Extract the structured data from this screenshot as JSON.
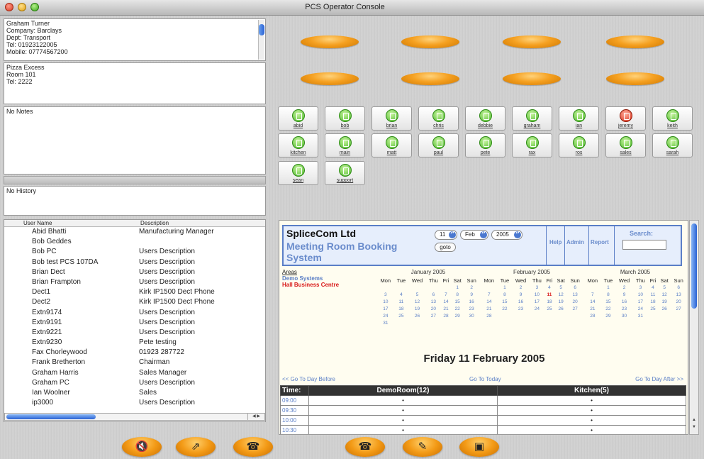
{
  "window": {
    "title": "PCS Operator Console"
  },
  "contact": {
    "lines": [
      "Graham Turner",
      "Company: Barclays",
      "Dept: Transport",
      "Tel: 01923122005",
      "Mobile: 07774567200"
    ]
  },
  "location": {
    "lines": [
      "Pizza Excess",
      "Room 101",
      "Tel: 2222"
    ]
  },
  "notes": {
    "text": "No Notes"
  },
  "history": {
    "text": "No History"
  },
  "user_table": {
    "columns": [
      "User Name",
      "Description"
    ],
    "rows": [
      [
        "Abid Bhatti",
        "Manufacturing Manager"
      ],
      [
        "Bob Geddes",
        ""
      ],
      [
        "Bob PC",
        "Users Description"
      ],
      [
        "Bob test PCS 107DA",
        "Users Description"
      ],
      [
        "Brian Dect",
        "Users Description"
      ],
      [
        "Brian Frampton",
        "Users Description"
      ],
      [
        "Dect1",
        "Kirk IP1500 Dect Phone"
      ],
      [
        "Dect2",
        "Kirk IP1500 Dect Phone"
      ],
      [
        "Extn9174",
        "Users Description"
      ],
      [
        "Extn9191",
        "Users Description"
      ],
      [
        "Extn9221",
        "Users Description"
      ],
      [
        "Extn9230",
        "Pete testing"
      ],
      [
        "Fax Chorleywood",
        "01923 287722"
      ],
      [
        "Frank Bretherton",
        "Chairman"
      ],
      [
        "Graham Harris",
        "Sales Manager"
      ],
      [
        "Graham PC",
        "Users Description"
      ],
      [
        "Ian Woolner",
        "Sales"
      ],
      [
        "ip3000",
        "Users Description"
      ]
    ]
  },
  "extensions": [
    {
      "label": "abid",
      "state": "idle"
    },
    {
      "label": "bob",
      "state": "idle"
    },
    {
      "label": "brian",
      "state": "idle"
    },
    {
      "label": "chris",
      "state": "idle"
    },
    {
      "label": "debbie",
      "state": "idle"
    },
    {
      "label": "graham",
      "state": "idle"
    },
    {
      "label": "ian",
      "state": "idle"
    },
    {
      "label": "jeremy",
      "state": "busy"
    },
    {
      "label": "keith",
      "state": "idle"
    },
    {
      "label": "kitchen",
      "state": "idle"
    },
    {
      "label": "main",
      "state": "idle"
    },
    {
      "label": "matt",
      "state": "idle"
    },
    {
      "label": "paul",
      "state": "idle"
    },
    {
      "label": "pete",
      "state": "idle"
    },
    {
      "label": "rax",
      "state": "idle"
    },
    {
      "label": "ros",
      "state": "idle"
    },
    {
      "label": "sales",
      "state": "idle"
    },
    {
      "label": "sarah",
      "state": "idle"
    },
    {
      "label": "sean",
      "state": "idle"
    },
    {
      "label": "support",
      "state": "idle"
    }
  ],
  "booking": {
    "company": "SpliceCom Ltd",
    "system_title": "Meeting Room Booking System",
    "day_select": "11",
    "month_select": "Feb",
    "year_select": "2005",
    "goto_label": "goto",
    "links": [
      "Help",
      "Admin",
      "Report"
    ],
    "search_label": "Search:",
    "areas_title": "Areas",
    "areas": [
      "Demo Systems",
      "Hall Business Centre"
    ],
    "weekdays": [
      "Mon",
      "Tue",
      "Wed",
      "Thu",
      "Fri",
      "Sat",
      "Sun"
    ],
    "calendars": [
      {
        "title": "January 2005",
        "weeks": [
          [
            "",
            "",
            "",
            "",
            "",
            "1",
            "2"
          ],
          [
            "3",
            "4",
            "5",
            "6",
            "7",
            "8",
            "9"
          ],
          [
            "10",
            "11",
            "12",
            "13",
            "14",
            "15",
            "16"
          ],
          [
            "17",
            "18",
            "19",
            "20",
            "21",
            "22",
            "23"
          ],
          [
            "24",
            "25",
            "26",
            "27",
            "28",
            "29",
            "30"
          ],
          [
            "31",
            "",
            "",
            "",
            "",
            "",
            ""
          ]
        ]
      },
      {
        "title": "February 2005",
        "weeks": [
          [
            "",
            "1",
            "2",
            "3",
            "4",
            "5",
            "6"
          ],
          [
            "7",
            "8",
            "9",
            "10",
            "11",
            "12",
            "13"
          ],
          [
            "14",
            "15",
            "16",
            "17",
            "18",
            "19",
            "20"
          ],
          [
            "21",
            "22",
            "23",
            "24",
            "25",
            "26",
            "27"
          ],
          [
            "28",
            "",
            "",
            "",
            "",
            "",
            ""
          ]
        ]
      },
      {
        "title": "March 2005",
        "weeks": [
          [
            "",
            "1",
            "2",
            "3",
            "4",
            "5",
            "6"
          ],
          [
            "7",
            "8",
            "9",
            "10",
            "11",
            "12",
            "13"
          ],
          [
            "14",
            "15",
            "16",
            "17",
            "18",
            "19",
            "20"
          ],
          [
            "21",
            "22",
            "23",
            "24",
            "25",
            "26",
            "27"
          ],
          [
            "28",
            "29",
            "30",
            "31",
            "",
            "",
            ""
          ]
        ]
      }
    ],
    "highlight_day": "11",
    "date_heading": "Friday 11 February 2005",
    "nav_before": "<< Go To Day Before",
    "nav_today": "Go To Today",
    "nav_after": "Go To Day After >>",
    "grid_headers": [
      "Time:",
      "DemoRoom(12)",
      "Kitchen(5)"
    ],
    "times": [
      "09:00",
      "09:30",
      "10:00",
      "10:30"
    ],
    "slot_mark": "•"
  },
  "toolbar": {
    "buttons": [
      {
        "name": "mute-button",
        "icon": "speaker-icon",
        "glyph": "🔇"
      },
      {
        "name": "transfer-button",
        "icon": "transfer-arrow-icon",
        "glyph": "⇗"
      },
      {
        "name": "hangup-button",
        "icon": "handset-down-icon",
        "glyph": "☎"
      },
      {
        "name": "answer-button",
        "icon": "handset-up-icon",
        "glyph": "☎"
      },
      {
        "name": "notes-button",
        "icon": "notepad-icon",
        "glyph": "✎"
      },
      {
        "name": "directory-button",
        "icon": "directory-icon",
        "glyph": "▣"
      }
    ]
  },
  "colors": {
    "lamp": "#f5a020",
    "link": "#5a7ec6",
    "today": "#d81a1a"
  }
}
